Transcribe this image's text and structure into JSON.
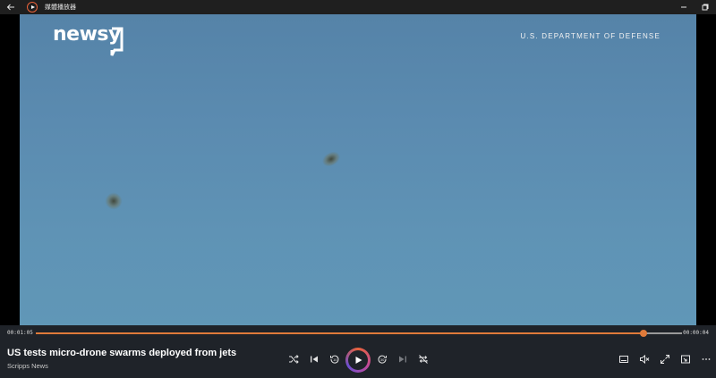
{
  "window": {
    "title": "媒體播放器"
  },
  "video": {
    "logo_text": "newsy",
    "watermark": "U.S. DEPARTMENT OF DEFENSE"
  },
  "playback": {
    "elapsed": "00:01:05",
    "remaining": "00:00:04",
    "progress_fraction": 0.94,
    "accent_color": "#e07a3a"
  },
  "media": {
    "title": "US tests micro-drone swarms deployed from jets",
    "source": "Scripps News"
  },
  "icons": {
    "titlebar": [
      "back-arrow-icon",
      "app-icon",
      "minimize-icon",
      "restore-icon"
    ],
    "transport": [
      "shuffle-icon",
      "previous-icon",
      "rewind-10-icon",
      "play-icon",
      "forward-30-icon",
      "next-icon",
      "repeat-off-icon"
    ],
    "right": [
      "subtitles-icon",
      "mute-icon",
      "fullscreen-icon",
      "mini-player-icon",
      "more-icon"
    ]
  }
}
